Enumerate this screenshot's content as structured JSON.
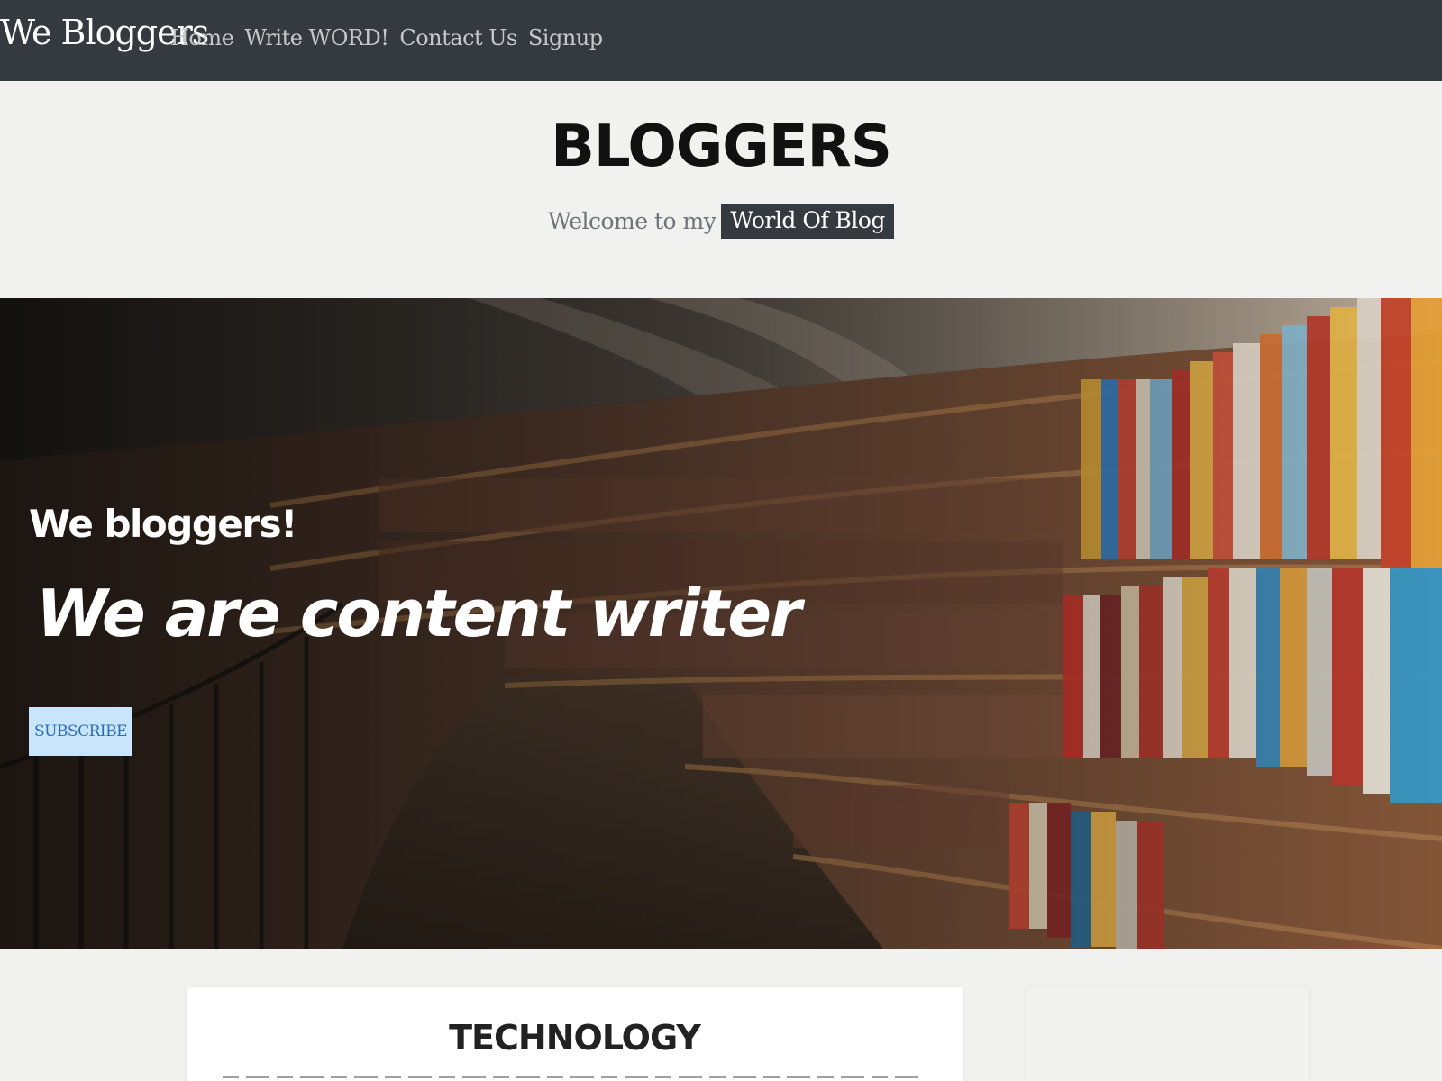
{
  "navbar": {
    "brand": "We Bloggers",
    "links": [
      "Home",
      "Write WORD!",
      "Contact Us",
      "Signup"
    ]
  },
  "header": {
    "title": "BLOGGERS",
    "welcome_text": "Welcome to my",
    "welcome_badge": "World Of Blog"
  },
  "hero": {
    "kicker": "We bloggers!",
    "heading": "We are  content writer",
    "subscribe_label": "SUBSCRIBE"
  },
  "main": {
    "card_title": "TECHNOLOGY"
  },
  "colors": {
    "navbar_bg": "#353a40",
    "page_bg": "#f1f1f0",
    "subscribe_bg": "#c9e5fc",
    "subscribe_text": "#2c6db3"
  },
  "icons": [
    "library-bookshelf-image"
  ]
}
